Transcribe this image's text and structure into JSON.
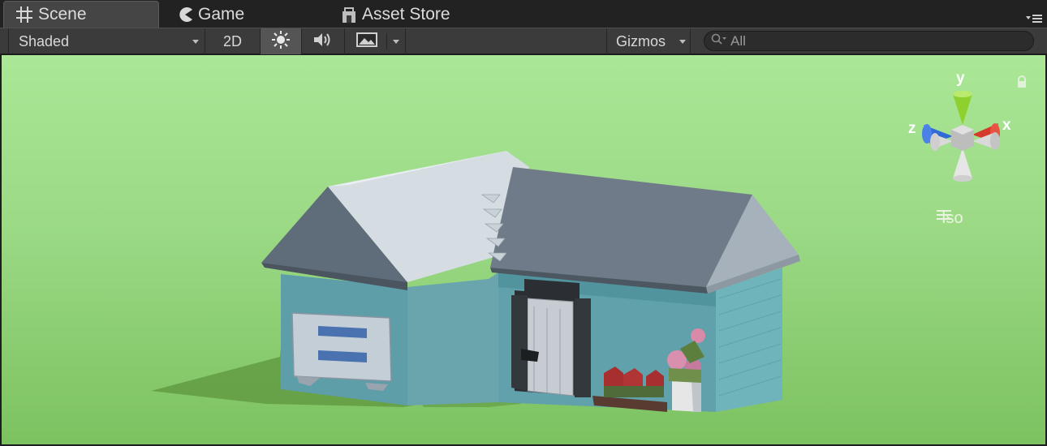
{
  "tabs": [
    {
      "label": "Scene",
      "icon": "grid-icon",
      "active": true
    },
    {
      "label": "Game",
      "icon": "pacman-icon",
      "active": false
    },
    {
      "label": "Asset Store",
      "icon": "store-icon",
      "active": false
    }
  ],
  "toolbar": {
    "draw_mode": "Shaded",
    "mode_2d": "2D",
    "lighting_icon": "sun-icon",
    "audio_icon": "speaker-icon",
    "effects_icon": "landscape-icon",
    "gizmos": "Gizmos",
    "search_placeholder": "All"
  },
  "scene": {
    "axis_labels": {
      "y": "y",
      "z": "z",
      "x": "x"
    },
    "projection": "Iso",
    "colors": {
      "sky": "#a7e394",
      "ground": "#7fc463",
      "wall": "#64a7b0",
      "roof_dark": "#6f7b88",
      "roof_light": "#d5dde2"
    }
  }
}
